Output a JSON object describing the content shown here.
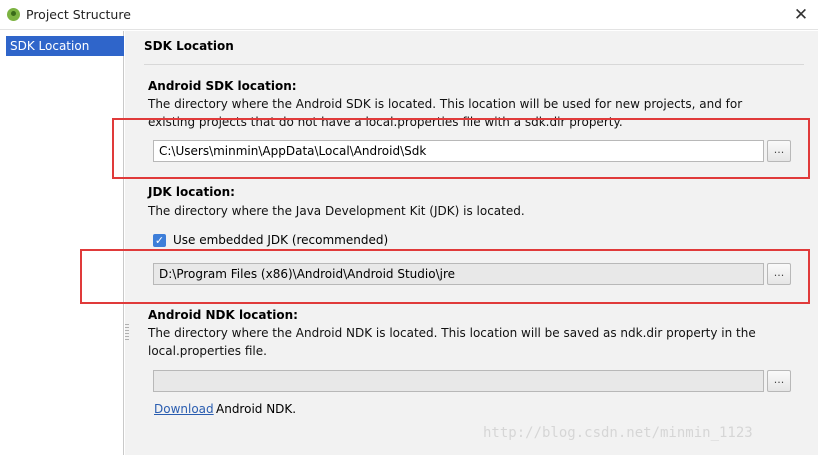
{
  "window": {
    "title": "Project Structure",
    "close_label": "✕"
  },
  "sidebar": {
    "items": [
      {
        "label": "SDK Location",
        "selected": true
      }
    ]
  },
  "main": {
    "title": "SDK Location",
    "sdk": {
      "heading": "Android SDK location:",
      "description": "The directory where the Android SDK is located. This location will be used for new projects, and for existing projects that do not have a local.properties file with a sdk.dir property.",
      "path": "C:\\Users\\minmin\\AppData\\Local\\Android\\Sdk",
      "browse_label": "..."
    },
    "jdk": {
      "heading": "JDK location:",
      "description": "The directory where the Java Development Kit (JDK) is located.",
      "use_embedded_label": "Use embedded JDK (recommended)",
      "use_embedded_checked": true,
      "path": "D:\\Program Files (x86)\\Android\\Android Studio\\jre",
      "browse_label": "..."
    },
    "ndk": {
      "heading": "Android NDK location:",
      "description": "The directory where the Android NDK is located. This location will be saved as ndk.dir property in the local.properties file.",
      "path": "",
      "browse_label": "...",
      "download_link": "Download",
      "download_suffix": "Android NDK."
    }
  },
  "watermark": "http://blog.csdn.net/minmin_1123",
  "colors": {
    "selection": "#2f65ca",
    "annotation": "#e03a3a",
    "link": "#2a5db0",
    "checkbox": "#3d7ed9"
  }
}
